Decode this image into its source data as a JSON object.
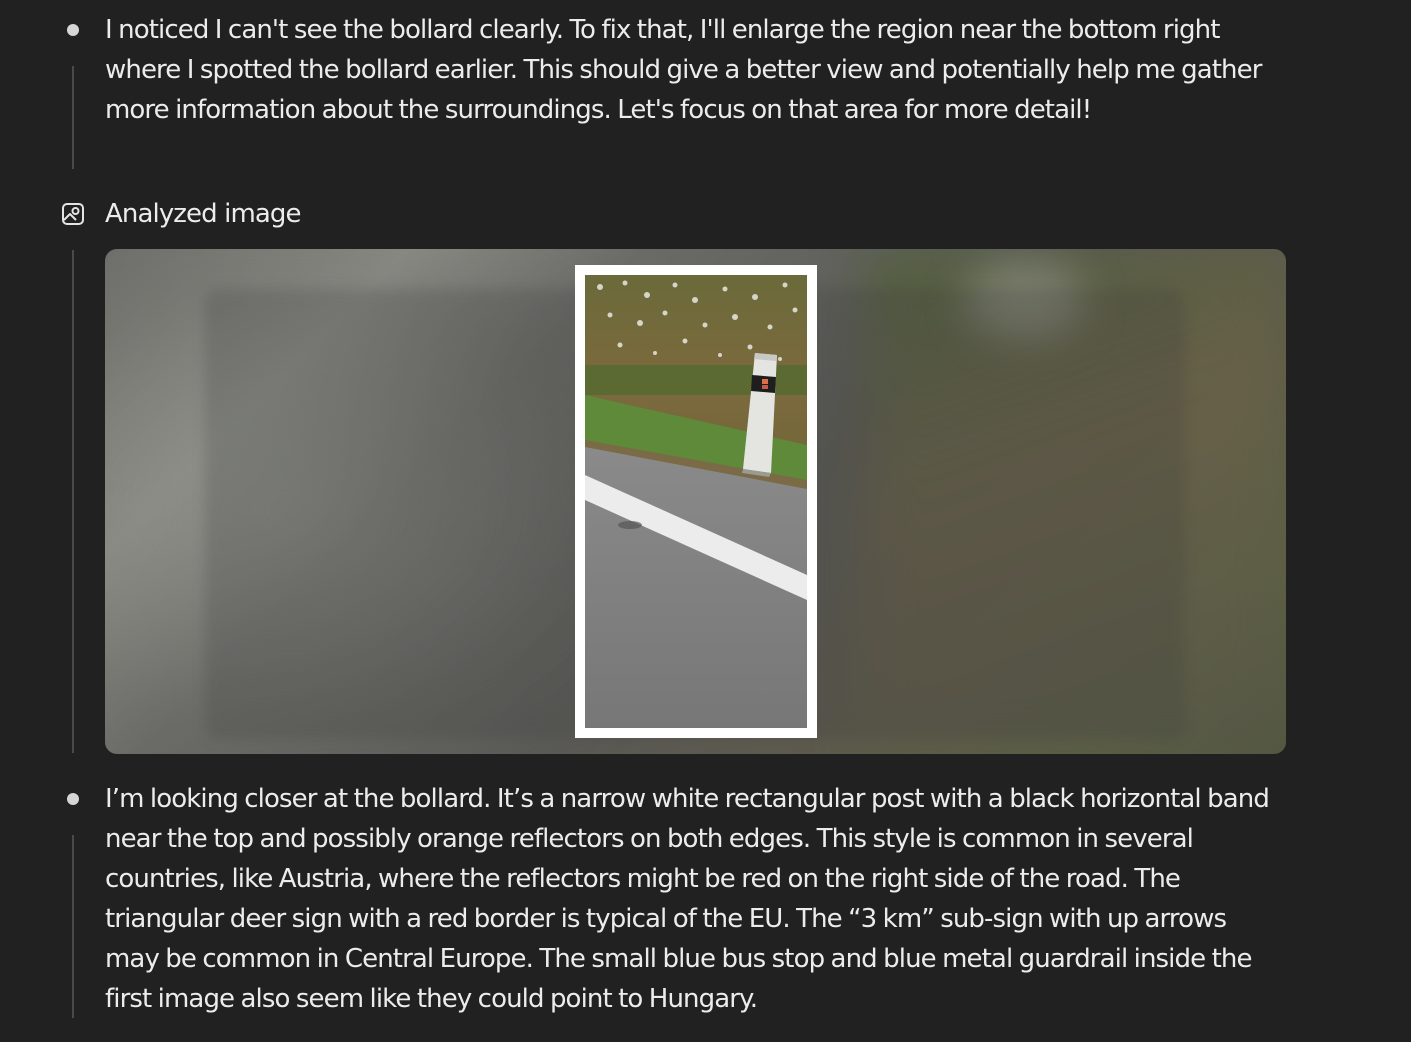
{
  "thoughts": [
    {
      "text": "I noticed I can't see the bollard clearly. To fix that, I'll enlarge the region near the bottom right where I spotted the bollard earlier. This should give a better view and potentially help me gather more information about the surroundings. Let's focus on that area for more detail!"
    },
    {
      "text": "I’m looking closer at the bollard. It’s a narrow white rectangular post with a black horizontal band near the top and possibly orange reflectors on both edges. This style is common in several countries, like Austria, where the reflectors might be red on the right side of the road. The triangular deer sign with a red border is typical of the EU. The “3 km” sub-sign with up arrows may be common in Central Europe. The small blue bus stop and blue metal guardrail inside the first image also seem like they could point to Hungary."
    }
  ],
  "tool_step": {
    "label": "Analyzed image",
    "icon": "image-analyze-icon"
  },
  "colors": {
    "background": "#212121",
    "text": "#ececec",
    "bullet": "#d6d6d6",
    "rail": "#4a4a4a"
  }
}
